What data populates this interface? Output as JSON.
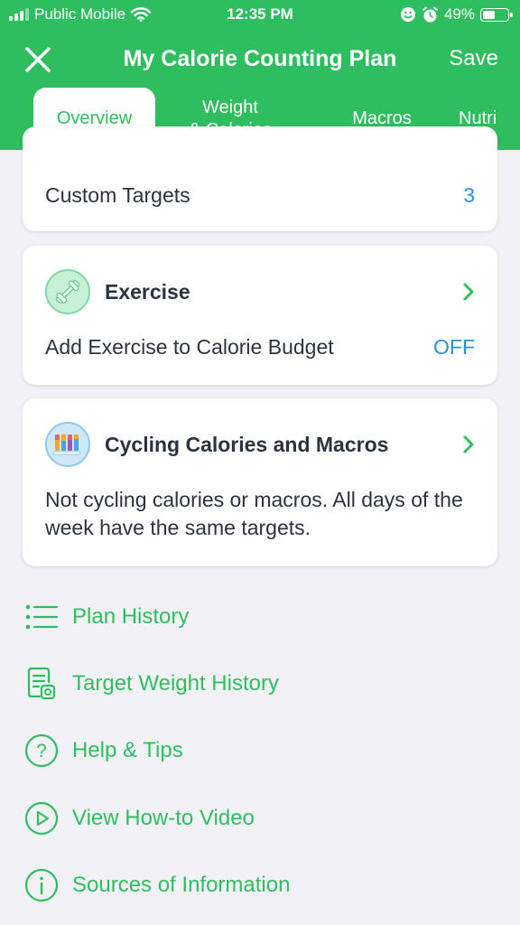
{
  "status_bar": {
    "carrier": "Public Mobile",
    "time": "12:35 PM",
    "battery": "49%",
    "battery_level": 0.49
  },
  "nav": {
    "title": "My Calorie Counting Plan",
    "save_label": "Save"
  },
  "tabs": [
    {
      "label": "Overview",
      "active": true
    },
    {
      "label": "Weight\n& Calories",
      "line1": "Weight",
      "line2": "& Calories",
      "active": false
    },
    {
      "label": "Macros",
      "active": false
    },
    {
      "label": "Nutri",
      "active": false
    }
  ],
  "cards": {
    "targets": {
      "label": "Custom Targets",
      "value": "3"
    },
    "exercise": {
      "title": "Exercise",
      "row_label": "Add Exercise to Calorie Budget",
      "row_value": "OFF",
      "icon": "dumbbell-icon"
    },
    "cycling": {
      "title": "Cycling Calories and Macros",
      "description": "Not cycling calories or macros. All days of the week have the same targets.",
      "icon": "bars-icon"
    }
  },
  "links": [
    {
      "label": "Plan History",
      "icon": "list-icon"
    },
    {
      "label": "Target Weight History",
      "icon": "history-document-icon"
    },
    {
      "label": "Help & Tips",
      "icon": "question-icon"
    },
    {
      "label": "View How-to Video",
      "icon": "play-icon"
    },
    {
      "label": "Sources of Information",
      "icon": "info-icon"
    }
  ],
  "colors": {
    "brand_green": "#2fbe5f",
    "value_blue": "#2a93d5",
    "text_dark": "#2b3340",
    "background": "#f2f2f6"
  }
}
